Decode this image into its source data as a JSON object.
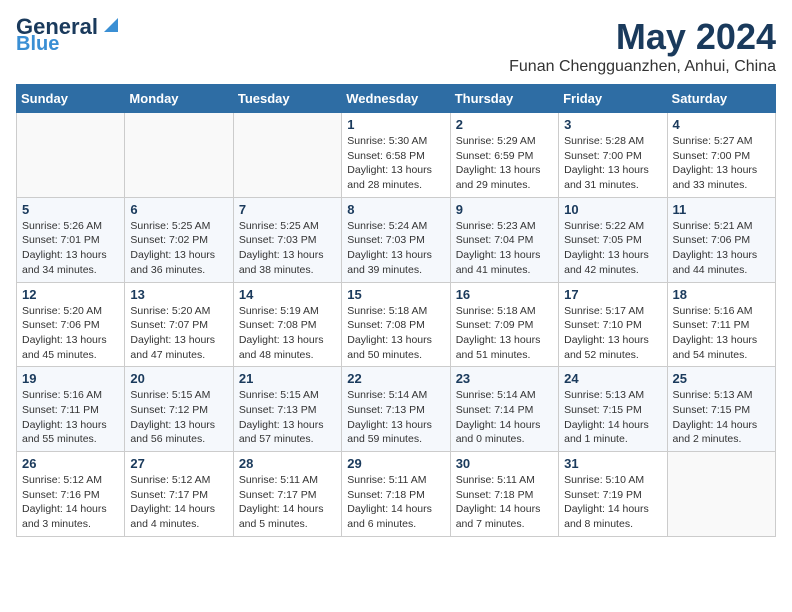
{
  "header": {
    "logo_line1": "General",
    "logo_line2": "Blue",
    "month_year": "May 2024",
    "location": "Funan Chengguanzhen, Anhui, China"
  },
  "weekdays": [
    "Sunday",
    "Monday",
    "Tuesday",
    "Wednesday",
    "Thursday",
    "Friday",
    "Saturday"
  ],
  "weeks": [
    [
      {
        "day": "",
        "info": ""
      },
      {
        "day": "",
        "info": ""
      },
      {
        "day": "",
        "info": ""
      },
      {
        "day": "1",
        "info": "Sunrise: 5:30 AM\nSunset: 6:58 PM\nDaylight: 13 hours\nand 28 minutes."
      },
      {
        "day": "2",
        "info": "Sunrise: 5:29 AM\nSunset: 6:59 PM\nDaylight: 13 hours\nand 29 minutes."
      },
      {
        "day": "3",
        "info": "Sunrise: 5:28 AM\nSunset: 7:00 PM\nDaylight: 13 hours\nand 31 minutes."
      },
      {
        "day": "4",
        "info": "Sunrise: 5:27 AM\nSunset: 7:00 PM\nDaylight: 13 hours\nand 33 minutes."
      }
    ],
    [
      {
        "day": "5",
        "info": "Sunrise: 5:26 AM\nSunset: 7:01 PM\nDaylight: 13 hours\nand 34 minutes."
      },
      {
        "day": "6",
        "info": "Sunrise: 5:25 AM\nSunset: 7:02 PM\nDaylight: 13 hours\nand 36 minutes."
      },
      {
        "day": "7",
        "info": "Sunrise: 5:25 AM\nSunset: 7:03 PM\nDaylight: 13 hours\nand 38 minutes."
      },
      {
        "day": "8",
        "info": "Sunrise: 5:24 AM\nSunset: 7:03 PM\nDaylight: 13 hours\nand 39 minutes."
      },
      {
        "day": "9",
        "info": "Sunrise: 5:23 AM\nSunset: 7:04 PM\nDaylight: 13 hours\nand 41 minutes."
      },
      {
        "day": "10",
        "info": "Sunrise: 5:22 AM\nSunset: 7:05 PM\nDaylight: 13 hours\nand 42 minutes."
      },
      {
        "day": "11",
        "info": "Sunrise: 5:21 AM\nSunset: 7:06 PM\nDaylight: 13 hours\nand 44 minutes."
      }
    ],
    [
      {
        "day": "12",
        "info": "Sunrise: 5:20 AM\nSunset: 7:06 PM\nDaylight: 13 hours\nand 45 minutes."
      },
      {
        "day": "13",
        "info": "Sunrise: 5:20 AM\nSunset: 7:07 PM\nDaylight: 13 hours\nand 47 minutes."
      },
      {
        "day": "14",
        "info": "Sunrise: 5:19 AM\nSunset: 7:08 PM\nDaylight: 13 hours\nand 48 minutes."
      },
      {
        "day": "15",
        "info": "Sunrise: 5:18 AM\nSunset: 7:08 PM\nDaylight: 13 hours\nand 50 minutes."
      },
      {
        "day": "16",
        "info": "Sunrise: 5:18 AM\nSunset: 7:09 PM\nDaylight: 13 hours\nand 51 minutes."
      },
      {
        "day": "17",
        "info": "Sunrise: 5:17 AM\nSunset: 7:10 PM\nDaylight: 13 hours\nand 52 minutes."
      },
      {
        "day": "18",
        "info": "Sunrise: 5:16 AM\nSunset: 7:11 PM\nDaylight: 13 hours\nand 54 minutes."
      }
    ],
    [
      {
        "day": "19",
        "info": "Sunrise: 5:16 AM\nSunset: 7:11 PM\nDaylight: 13 hours\nand 55 minutes."
      },
      {
        "day": "20",
        "info": "Sunrise: 5:15 AM\nSunset: 7:12 PM\nDaylight: 13 hours\nand 56 minutes."
      },
      {
        "day": "21",
        "info": "Sunrise: 5:15 AM\nSunset: 7:13 PM\nDaylight: 13 hours\nand 57 minutes."
      },
      {
        "day": "22",
        "info": "Sunrise: 5:14 AM\nSunset: 7:13 PM\nDaylight: 13 hours\nand 59 minutes."
      },
      {
        "day": "23",
        "info": "Sunrise: 5:14 AM\nSunset: 7:14 PM\nDaylight: 14 hours\nand 0 minutes."
      },
      {
        "day": "24",
        "info": "Sunrise: 5:13 AM\nSunset: 7:15 PM\nDaylight: 14 hours\nand 1 minute."
      },
      {
        "day": "25",
        "info": "Sunrise: 5:13 AM\nSunset: 7:15 PM\nDaylight: 14 hours\nand 2 minutes."
      }
    ],
    [
      {
        "day": "26",
        "info": "Sunrise: 5:12 AM\nSunset: 7:16 PM\nDaylight: 14 hours\nand 3 minutes."
      },
      {
        "day": "27",
        "info": "Sunrise: 5:12 AM\nSunset: 7:17 PM\nDaylight: 14 hours\nand 4 minutes."
      },
      {
        "day": "28",
        "info": "Sunrise: 5:11 AM\nSunset: 7:17 PM\nDaylight: 14 hours\nand 5 minutes."
      },
      {
        "day": "29",
        "info": "Sunrise: 5:11 AM\nSunset: 7:18 PM\nDaylight: 14 hours\nand 6 minutes."
      },
      {
        "day": "30",
        "info": "Sunrise: 5:11 AM\nSunset: 7:18 PM\nDaylight: 14 hours\nand 7 minutes."
      },
      {
        "day": "31",
        "info": "Sunrise: 5:10 AM\nSunset: 7:19 PM\nDaylight: 14 hours\nand 8 minutes."
      },
      {
        "day": "",
        "info": ""
      }
    ]
  ]
}
